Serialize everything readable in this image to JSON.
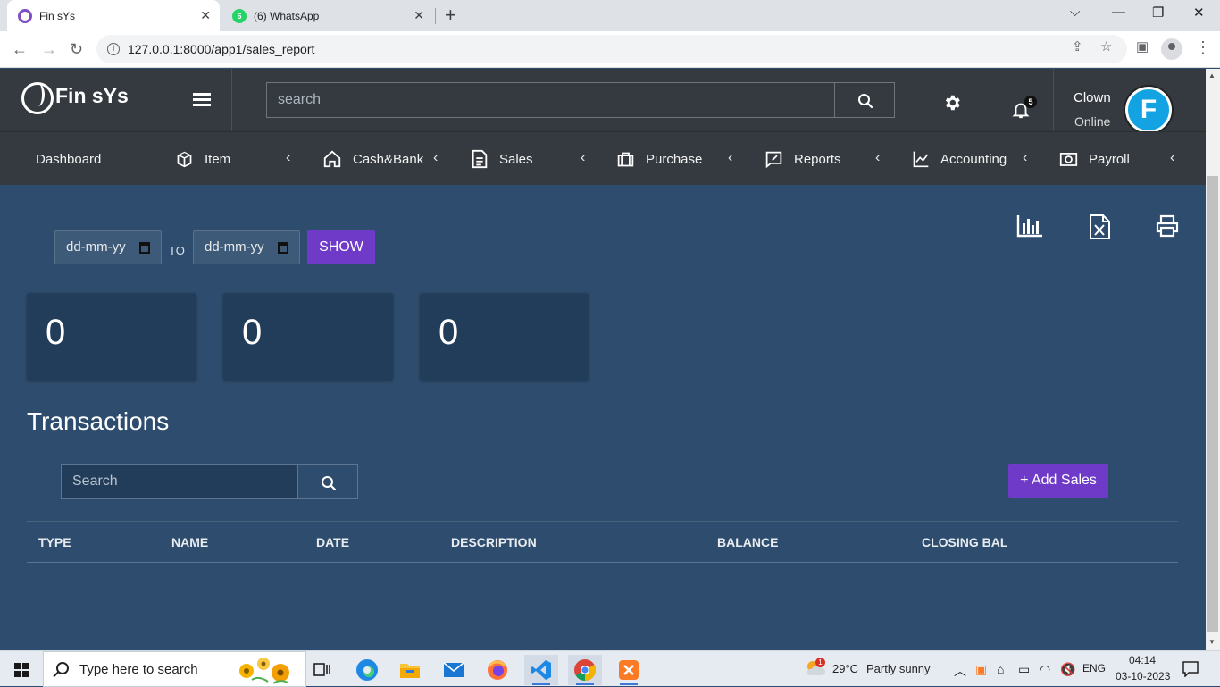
{
  "browser": {
    "tabs": [
      {
        "title": "Fin sYs",
        "active": true
      },
      {
        "title": "(6) WhatsApp",
        "active": false,
        "badge": "6"
      }
    ],
    "url": "127.0.0.1:8000/app1/sales_report"
  },
  "header": {
    "brand": "Fin sYs",
    "search_placeholder": "search",
    "notification_count": "5",
    "user_name": "Clown",
    "user_status": "Online",
    "avatar_letter": "F"
  },
  "nav": {
    "items": [
      {
        "label": "Dashboard",
        "icon": "dashboard"
      },
      {
        "label": "Item",
        "icon": "box-icon"
      },
      {
        "label": "Cash&Bank",
        "icon": "home-icon"
      },
      {
        "label": "Sales",
        "icon": "document-icon"
      },
      {
        "label": "Purchase",
        "icon": "briefcase-icon"
      },
      {
        "label": "Reports",
        "icon": "chat-edit-icon"
      },
      {
        "label": "Accounting",
        "icon": "line-chart-icon"
      },
      {
        "label": "Payroll",
        "icon": "camera-icon"
      }
    ],
    "chevron": "‹"
  },
  "filters": {
    "from_placeholder": "dd-mm-yy",
    "to_label": "TO",
    "to_placeholder": "dd-mm-yy",
    "show_label": "SHOW"
  },
  "stats": [
    "0",
    "0",
    "0"
  ],
  "transactions": {
    "title": "Transactions",
    "search_placeholder": "Search",
    "add_label": "+ Add Sales",
    "columns": [
      "TYPE",
      "NAME",
      "DATE",
      "DESCRIPTION",
      "BALANCE",
      "CLOSING BAL"
    ],
    "rows": []
  },
  "taskbar": {
    "search_placeholder": "Type here to search",
    "weather_temp": "29°C",
    "weather_desc": "Partly sunny",
    "weather_badge": "1",
    "language": "ENG",
    "time": "04:14",
    "date": "03-10-2023"
  },
  "colors": {
    "header_bg": "#343a40",
    "content_bg": "#2e4c6d",
    "card_bg": "#223d5a",
    "accent_purple": "#6f3ac8",
    "avatar_blue": "#13a3e3"
  }
}
